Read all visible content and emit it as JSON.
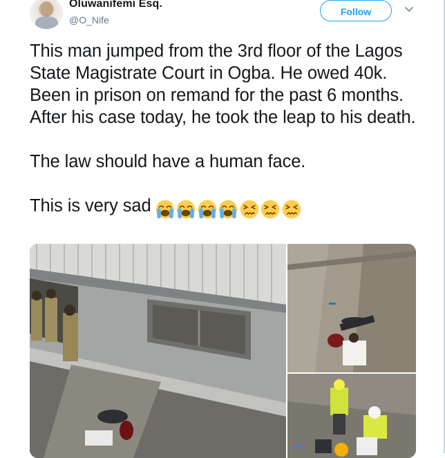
{
  "tweet": {
    "author_name": "Oluwanifemi Esq.",
    "author_handle": "@O_Nife",
    "follow_label": "Follow",
    "paragraphs": [
      "This man jumped from the 3rd floor of the Lagos State Magistrate Court in Ogba. He owed 40k. Been in prison on remand for the past 6 months. After his case today, he took the leap to his death.",
      "The law should have a human face.",
      "This is very sad"
    ],
    "emojis": [
      "loudly-crying-face",
      "loudly-crying-face",
      "loudly-crying-face",
      "loudly-crying-face",
      "confounded-face",
      "confounded-face",
      "confounded-face"
    ],
    "media": [
      {
        "name": "photo-building-ledge"
      },
      {
        "name": "photo-man-on-ground"
      },
      {
        "name": "photo-rescue-workers"
      }
    ]
  },
  "colors": {
    "accent": "#1da1f2",
    "text": "#14171a",
    "secondary": "#657786"
  }
}
